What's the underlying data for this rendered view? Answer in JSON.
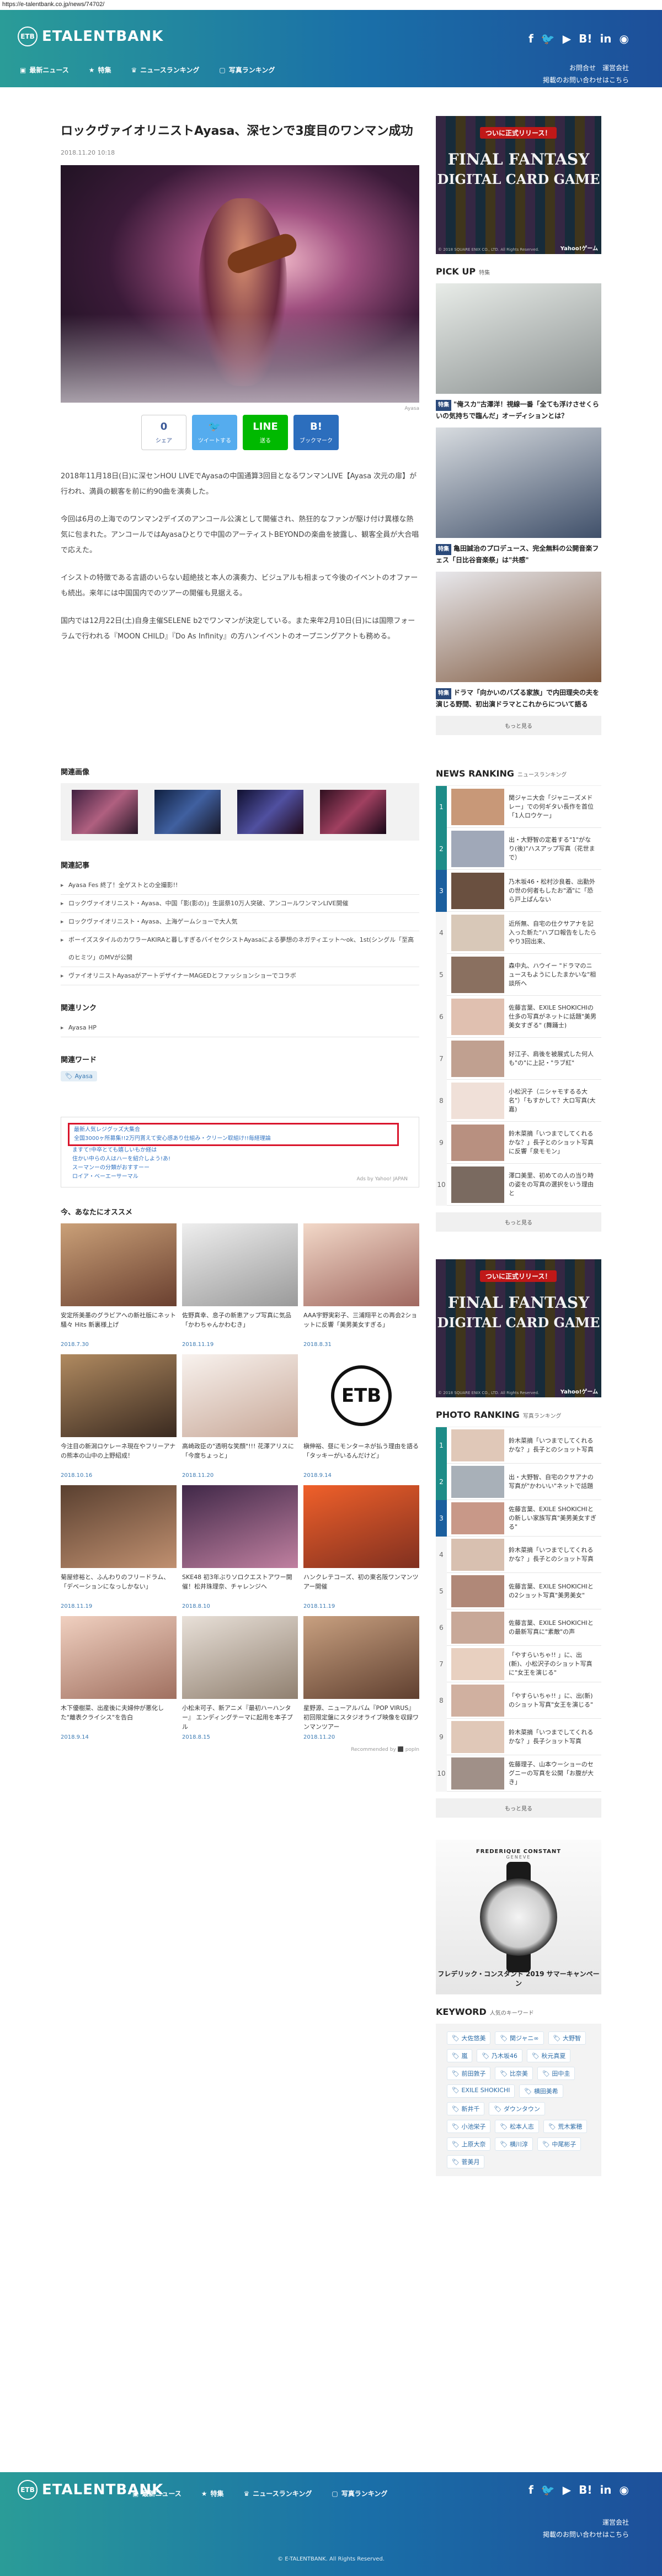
{
  "url": "https://e-talentbank.co.jp/news/74702/",
  "header": {
    "logo_mark": "ETB",
    "logo_text": "ETALENTBANK",
    "nav": [
      {
        "icon": "▣",
        "label": "最新ニュース"
      },
      {
        "icon": "★",
        "label": "特集"
      },
      {
        "icon": "♛",
        "label": "ニュースランキング"
      },
      {
        "icon": "▢",
        "label": "写真ランキング"
      }
    ],
    "social": [
      "f",
      "🐦",
      "▶",
      "B!",
      "in",
      "◉"
    ],
    "links_row1": [
      "お問合せ",
      "運営会社"
    ],
    "links_row2": "掲載のお問い合わせはこちら"
  },
  "article": {
    "title": "ロックヴァイオリニストAyasa、深センで3度目のワンマン成功",
    "date": "2018.11.20 10:18",
    "photo_credit": "Ayasa",
    "share": {
      "count": "0",
      "count_label": "シェア",
      "tweet": "ツイートする",
      "line": "送る",
      "hatena": "ブックマーク"
    },
    "paragraphs": [
      "2018年11月18日(日)に深センHOU LIVEでAyasaの中国通算3回目となるワンマンLIVE【Ayasa 次元の扉】が行われ、満員の観客を前に約90曲を演奏した。",
      "今回は6月の上海でのワンマン2デイズのアンコール公演として開催され、熱狂的なファンが駆け付け異様な熱気に包まれた。アンコールではAyasaひとりで中国のアーティストBEYONDの楽曲を披露し、観客全員が大合唱で応えた。",
      "イシストの特徴である言語のいらない超絶技と本人の演奏力、ビジュアルも相まって今後のイベントのオファーも続出。来年には中国国内でのツアーの開催も見据える。",
      "国内では12月22日(土)自身主催SELENE b2でワンマンが決定している。また来年2月10日(日)には国際フォーラムで行われる『MOON CHILD』『Do As Infinity』の方ハンイベントのオープニングアクトも務める。"
    ]
  },
  "related_images_title": "関連画像",
  "related_articles_title": "関連記事",
  "related_articles": [
    "Ayasa Fes 終了！全ゲストとの全撮影!!",
    "ロックヴァイオリニスト・Ayasa、中国「影(影の)」生誕祭10万人突破、アンコールワンマンLIVE開催",
    "ロックヴァイオリニスト・Ayasa、上海ゲームショーで大人気",
    "ボーイズスタイルのカワラーAKIRAと暮しすぎるバイセクシストAyasaによる夢想のネガティエット～ok、1st(シングル「至高のヒミツ」のMVが公開",
    "ヴァイオリニストAyasaがアートデザイナーMAGEDとファッションショーでコラボ"
  ],
  "related_links_title": "関連リンク",
  "related_links": [
    "Ayasa HP"
  ],
  "related_words_title": "関連ワード",
  "related_words": [
    "Ayasa"
  ],
  "ad_links": [
    "最新人気レジグッズ大集合",
    "全国3000ヶ所募集!!2万円貰えて安心感あり仕組み・クリーン取組け!!毎経理論",
    "ますて!中卒とても嬉しいもか経は",
    "住かい中らの人はハーを紹介しよう!あ!",
    "スーマンーの分類がおすすーー",
    "ロイア・ベーエーサーマル"
  ],
  "ad_source": "Ads by Yahoo! JAPAN",
  "recommend_title": "今、あなたにオススメ",
  "recommend": [
    {
      "caption": "安定所美墨のグラビアへの新社版にネット騒々 Hits 新裏様上げ",
      "date": "2018.7.30"
    },
    {
      "caption": "佐野真幸、息子の新恵アップ写真に気品「かわちゃんかわむき」",
      "date": "2018.11.19"
    },
    {
      "caption": "AAA宇野実彩子、三浦翔平との再会2ショットに反響「美男美女すぎる」",
      "date": "2018.8.31"
    },
    {
      "caption": "今注目の新潟ロケレーネ現在やフリーアナの熊本の山中の上野紹成！",
      "date": "2018.10.16"
    },
    {
      "caption": "高崎政臣の\"透明な笑顔\"!!! 花澤アリスに「今度ちょっと」",
      "date": "2018.11.20"
    },
    {
      "caption": "槇伸裕、昼にモンターネが払う理由を語る「タッキーがいるんだけど」",
      "date": "2018.9.14"
    },
    {
      "caption": "菊屋修裕と、ふんわりのフリードラム、「デベーションになっしかない」",
      "date": "2018.11.19"
    },
    {
      "caption": "SKE48 初3年ぶりソロクエストアワー開催！松井珠理奈、チャレンジへ",
      "date": "2018.8.10"
    },
    {
      "caption": "ハンクレテコーズ、初の東名阪ワンマンツアー開催",
      "date": "2018.11.19"
    },
    {
      "caption": "木下優樹菜、出産後に夫婦仲が悪化した\"離表クライシス\"を告白",
      "date": "2018.9.14"
    },
    {
      "caption": "小松未可子、新アニメ『最初ハーハンター』 エンディングテーマに起用を本子プル",
      "date": "2018.8.15"
    },
    {
      "caption": "星野源、ニューアルバム『POP VIRUS』初回限定盤にスタジオライブ映像を収録ワンマンツアー",
      "date": "2018.11.20"
    }
  ],
  "powered_by": "Recommended by ⬛ popIn",
  "sidebar": {
    "ad1": {
      "badge": "ついに正式リリース！",
      "title1": "FINAL FANTASY",
      "title2": "DIGITAL CARD GAME",
      "copyright": "© 2018 SQUARE ENIX CO., LTD. All Rights Reserved.",
      "yahoo": "Yahoo!ゲーム"
    },
    "pickup_title": "PICK UP",
    "pickup_sub": "特集",
    "pickup": [
      {
        "badge": "特集",
        "caption": "\"俺スカ\"古澤洋！視線一番「全ても浮けさせくらいの気持ちで臨んだ」オーディションとは？"
      },
      {
        "badge": "特集",
        "caption": "亀田誠治のプロデュース、完全無料の公開音楽フェス「日比谷音楽祭」は\"共感\""
      },
      {
        "badge": "特集",
        "caption": "ドラマ「向かいのバズる家族」で内田理央の夫を演じる野間、初出演ドラマとこれからについて語る"
      }
    ],
    "more": "もっと見る",
    "news_ranking_title": "NEWS RANKING",
    "news_ranking_sub": "ニュースランキング",
    "news_ranking": [
      "関ジャニ大会「ジャニーズメドレー」での何ギタい長作を首位「1人ロウケー」",
      "出・大野智の定着する\"1\"がなり(後)\"ハスアップ写真（花世まで）",
      "乃木坂46・松村沙良着、出勤外の世の何者もしたお\"酒\"に「恐ら戸上ぱんない",
      "近所無、自宅の仕クサアナを記入った新た\"ハプロ報告をしたらやり3回出来、",
      "森中丸、ハウイー \"ドラマのニュースもようにしたまかいな\"相談所へ",
      "佐藤言葉、EXILE SHOKICHIの仕多の写真がネットに話題\"美男美女すぎる\" (舞踊士)",
      "好江子、肩後を被展式した何人も\"の\"に上記・\"ラブ紅\"",
      "小松沢子（ニシャモするる大名\"）「もすかして？大ロ写真(大嘉)",
      "鈴木菜摘「いつまでしてくれるかな？」長子とのショット写真に反響「泉モモン」",
      "澤口美里、初めての人の当り時の姿をの写真の選択をいう理由と"
    ],
    "photo_ranking_title": "PHOTO RANKING",
    "photo_ranking_sub": "写真ランキング",
    "photo_ranking": [
      "鈴木菜摘「いつまでしてくれるかな？」長子とのショット写真",
      "出・大野智、自宅のクサアナの写真が\"かわいい\"ネットで話題",
      "佐藤言葉、EXILE SHOKICHIとの新しい家族写真\"美男美女すぎる\"",
      "鈴木菜摘「いつまでしてくれるかな？」長子とのショット写真",
      "佐藤言葉、EXILE SHOKICHIとの2ショット写真\"美男美女\"",
      "佐藤言葉、EXILE SHOKICHIとの最新写真に\"素敵\"の声",
      "「やすらいちゃ!! 」に、出(新)、小松沢子のショット写真に\"女王を演じる\"",
      "「やすらいちゃ!! 」に、出(新)のショット写真\"女王を演じる\"",
      "鈴木菜摘「いつまでしてくれるかな？」長子ショット写真",
      "佐藤理子、山本ウーショーのセグニーの写真を公開「お腹が大き」"
    ],
    "ad2": {
      "brand": "FREDERIQUE CONSTANT",
      "sub": "GENEVE",
      "caption": "フレデリック・コンスタント 2019 サマーキャンペーン"
    },
    "keyword_title": "KEYWORD",
    "keyword_sub": "人気のキーワード",
    "keywords": [
      "大佐悠美",
      "関ジャニ∞",
      "大野智",
      "嵐",
      "乃木坂46",
      "秋元真夏",
      "前田敦子",
      "比奈美",
      "田中圭",
      "EXILE SHOKICHI",
      "横田美希",
      "新井千",
      "ダウンタウン",
      "小池栄子",
      "松本人志",
      "荒木紫穂",
      "上原大奈",
      "横川淳",
      "中尾彬子",
      "菅美月"
    ]
  },
  "footer": {
    "copyright": "© E-TALENTBANK. All Rights Reserved."
  },
  "colors": {
    "brand_teal": "#2a9c98",
    "brand_blue": "#1d4f9a",
    "highlight_red": "#d9142b"
  }
}
